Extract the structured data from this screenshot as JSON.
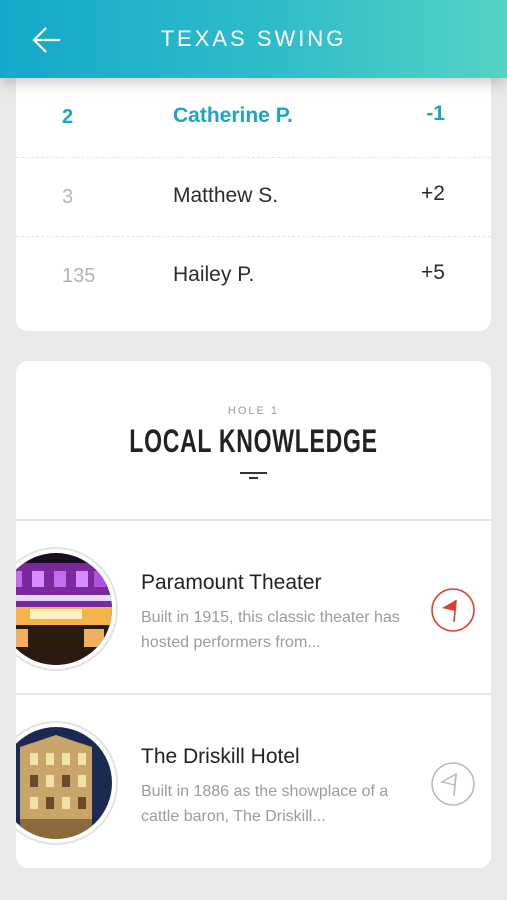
{
  "header": {
    "title": "TEXAS SWING"
  },
  "leaderboard": [
    {
      "rank": "2",
      "name": "Catherine P.",
      "score": "-1"
    },
    {
      "rank": "3",
      "name": "Matthew S.",
      "score": "+2"
    },
    {
      "rank": "135",
      "name": "Hailey P.",
      "score": "+5"
    }
  ],
  "local": {
    "eyebrow": "HOLE 1",
    "title": "LOCAL KNOWLEDGE",
    "places": [
      {
        "name": "Paramount Theater",
        "desc": "Built in 1915, this classic theater has hosted performers from...",
        "flag_color": "#e63b32",
        "flag_active": true
      },
      {
        "name": "The Driskill Hotel",
        "desc": "Built in 1886 as the showplace of a cattle baron, The Driskill...",
        "flag_color": "#b9b9b9",
        "flag_active": false
      }
    ]
  },
  "colors": {
    "accent": "#1ba3c9",
    "header_start": "#14a9cb",
    "header_end": "#55d3c4"
  }
}
